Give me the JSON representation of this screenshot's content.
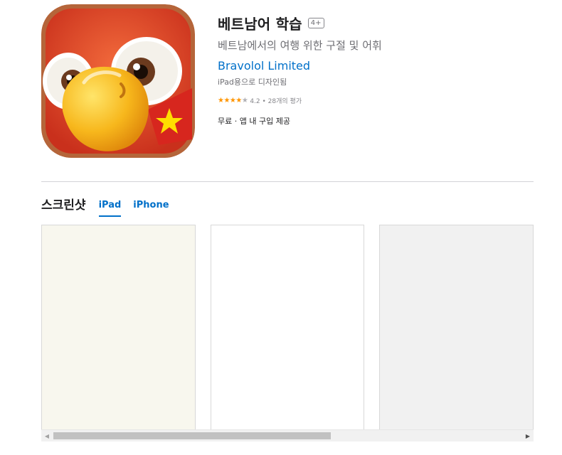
{
  "app": {
    "title": "베트남어 학습",
    "age_rating": "4+",
    "subtitle": "베트남에서의 여행 위한 구절 및 어휘",
    "developer": "Bravolol Limited",
    "designed_for": "iPad용으로 디자인됨",
    "rating_value": "4.2",
    "rating_count": "28개의 평가",
    "rating_text": "4.2 • 28개의 평가",
    "stars_filled": 4,
    "price_text": "무료 · 앱 내 구입 제공",
    "icon": "parrot-vietnam-flag-icon"
  },
  "screenshots": {
    "title": "스크린샷",
    "tabs": [
      {
        "label": "iPad",
        "active": true
      },
      {
        "label": "iPhone",
        "active": false
      }
    ]
  },
  "scrollbar": {
    "left_arrow": "◀",
    "right_arrow": "▶"
  },
  "colors": {
    "link": "#0070c9",
    "star": "#ff9500",
    "icon_bg": "#e8452c"
  }
}
